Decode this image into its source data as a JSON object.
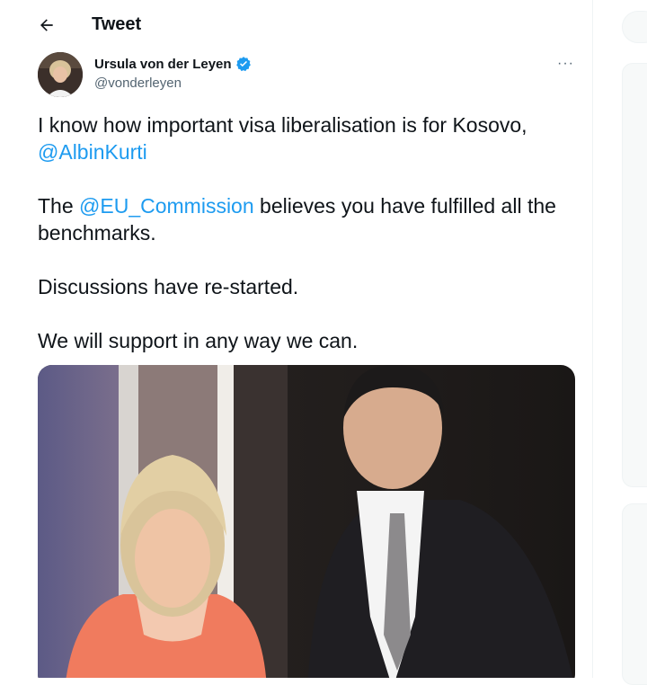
{
  "header": {
    "back_icon": "arrow-left-icon",
    "title": "Tweet"
  },
  "author": {
    "name": "Ursula von der Leyen",
    "handle": "@vonderleyen",
    "verified_icon": "verified-badge-icon",
    "more_icon": "more-horizontal-icon",
    "more_label": "···"
  },
  "tweet": {
    "line1": "I know how important visa liberalisation is for Kosovo,",
    "mention1": "@AlbinKurti",
    "line2_prefix": "The ",
    "mention2": "@EU_Commission",
    "line2_suffix": " believes you have fulfilled all the benchmarks.",
    "line3": "Discussions have re-started.",
    "line4": "We will support in any way we can."
  },
  "colors": {
    "accent": "#1d9bf0",
    "text": "#0f1419",
    "secondary": "#536471"
  }
}
